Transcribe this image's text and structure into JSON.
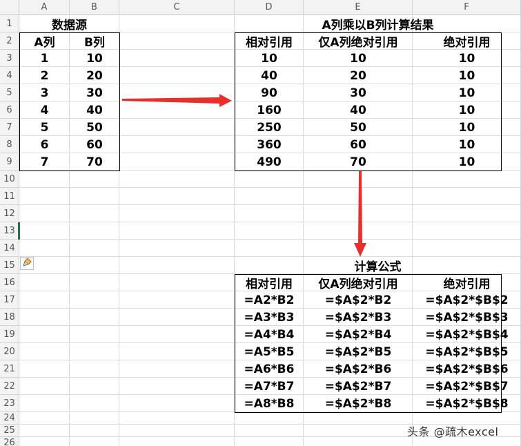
{
  "columns": [
    "A",
    "B",
    "C",
    "D",
    "E",
    "F"
  ],
  "rows": [
    "1",
    "2",
    "3",
    "4",
    "5",
    "6",
    "7",
    "8",
    "9",
    "10",
    "11",
    "12",
    "13",
    "14",
    "15",
    "16",
    "17",
    "18",
    "19",
    "20",
    "21",
    "22",
    "23",
    "24",
    "25",
    "26"
  ],
  "source": {
    "title": "数据源",
    "headers": [
      "A列",
      "B列"
    ],
    "a_values": [
      "1",
      "2",
      "3",
      "4",
      "5",
      "6",
      "7"
    ],
    "b_values": [
      "10",
      "20",
      "30",
      "40",
      "50",
      "60",
      "70"
    ]
  },
  "result": {
    "title": "A列乘以B列计算结果",
    "headers": [
      "相对引用",
      "仅A列绝对引用",
      "绝对引用"
    ],
    "relative": [
      "10",
      "40",
      "90",
      "160",
      "250",
      "360",
      "490"
    ],
    "a_absolute": [
      "10",
      "20",
      "30",
      "40",
      "50",
      "60",
      "70"
    ],
    "absolute": [
      "10",
      "10",
      "10",
      "10",
      "10",
      "10",
      "10"
    ]
  },
  "formulas": {
    "title": "计算公式",
    "headers": [
      "相对引用",
      "仅A列绝对引用",
      "绝对引用"
    ],
    "relative": [
      "=A2*B2",
      "=A3*B3",
      "=A4*B4",
      "=A5*B5",
      "=A6*B6",
      "=A7*B7",
      "=A8*B8"
    ],
    "a_absolute": [
      "=$A$2*B2",
      "=$A$2*B3",
      "=$A$2*B4",
      "=$A$2*B5",
      "=$A$2*B6",
      "=$A$2*B7",
      "=$A$2*B8"
    ],
    "absolute": [
      "=$A$2*$B$2",
      "=$A$2*$B$3",
      "=$A$2*$B$4",
      "=$A$2*$B$5",
      "=$A$2*$B$6",
      "=$A$2*$B$7",
      "=$A$2*$B$8"
    ]
  },
  "watermark": "头条 @疏木excel",
  "colors": {
    "arrow": "#e8302a",
    "selection": "#217346"
  },
  "icons": {
    "paste_options": "paintbrush-icon"
  }
}
